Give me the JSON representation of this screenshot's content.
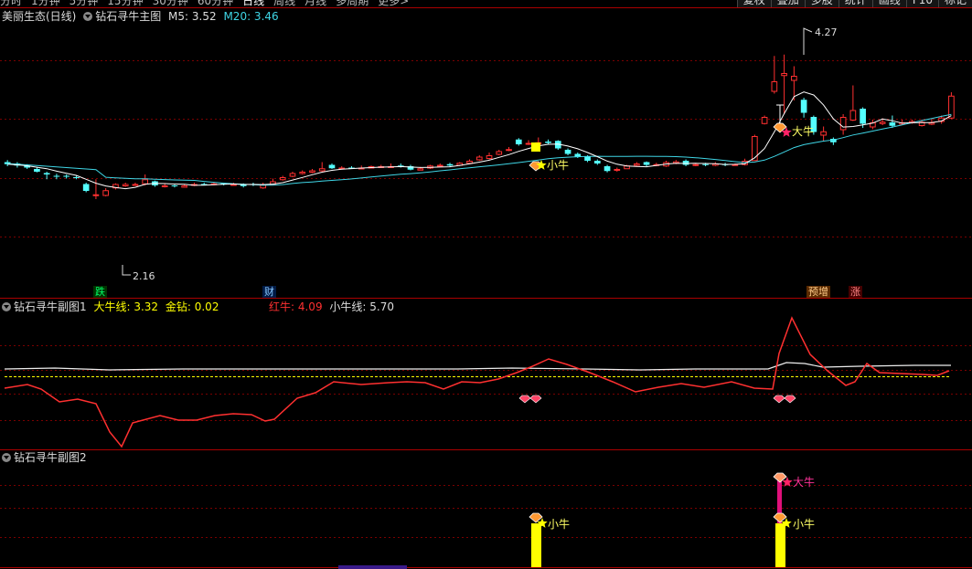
{
  "topbar": {
    "periods": [
      "分时",
      "1分钟",
      "5分钟",
      "15分钟",
      "30分钟",
      "60分钟",
      "日线",
      "周线",
      "月线",
      "多周期",
      "更多>"
    ],
    "active_period": "日线",
    "tools": [
      "复权",
      "叠加",
      "多股",
      "统计",
      "画线",
      "F10",
      "标记"
    ]
  },
  "main_panel": {
    "stock": "美丽生态(日线)",
    "indicator": "钻石寻牛主图",
    "ma5": "M5: 3.52",
    "ma20": "M20: 3.46",
    "high_label": "4.27",
    "low_label": "2.16",
    "xiaoniu_label": "小牛",
    "daniu_label": "大牛",
    "events": {
      "die": "跌",
      "cai": "财",
      "yuzeng": "预增",
      "zhang": "涨"
    }
  },
  "sub1": {
    "indicator": "钻石寻牛副图1",
    "daniu": "大牛线: 3.32",
    "jinzuan": "金钻: 0.02",
    "hongniu": "红牛: 4.09",
    "xiaoniu": "小牛线: 5.70"
  },
  "sub2": {
    "indicator": "钻石寻牛副图2",
    "xiaoniu_label": "小牛",
    "daniu_label": "大牛"
  },
  "colors": {
    "up": "#ff3030",
    "down": "#54ffff",
    "ma5": "#ffffff",
    "ma20": "#3fd6e6",
    "grid": "#7a0000",
    "yellow": "#ffff00",
    "magenta": "#ff1a75"
  }
}
